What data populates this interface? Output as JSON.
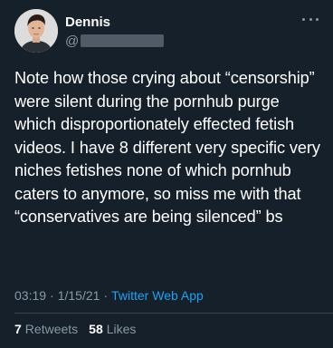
{
  "author": {
    "name": "Dennis",
    "handle_prefix": "@"
  },
  "tweet": {
    "text": "Note how those crying about “censorship” were silent during the pornhub purge which disproportionately effected fetish videos. I have 8 different very specific very niches fetishes none of which pornhub caters to anymore, so miss me with that “conservatives are being silenced” bs"
  },
  "meta": {
    "time": "03:19",
    "separator1": "·",
    "date": "1/15/21",
    "separator2": "·",
    "source": "Twitter Web App"
  },
  "stats": {
    "retweets_count": "7",
    "retweets_label": "Retweets",
    "likes_count": "58",
    "likes_label": "Likes"
  },
  "colors": {
    "background": "#15202b",
    "text": "#ffffff",
    "secondary": "#8899a6",
    "accent": "#1da1f2",
    "divider": "#38444d"
  },
  "icons": {
    "more": "more-horizontal-icon"
  }
}
